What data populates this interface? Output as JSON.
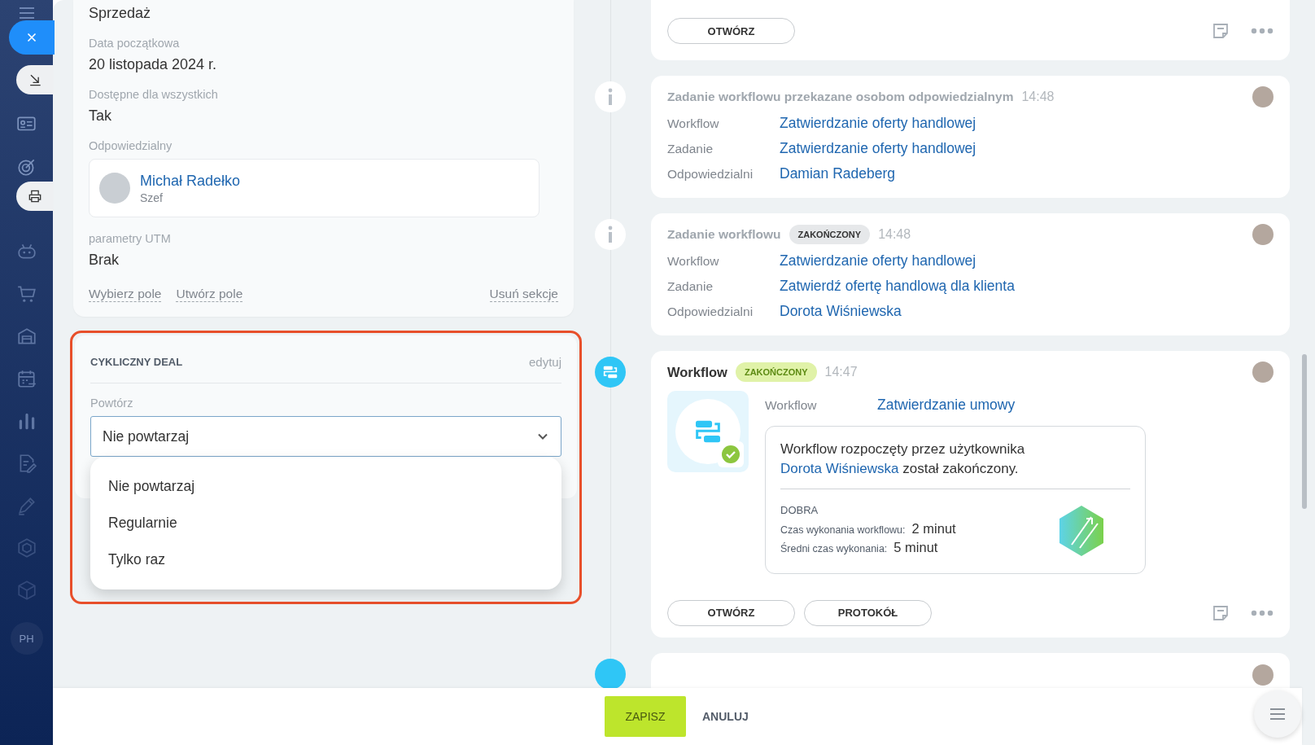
{
  "sidebar": {
    "avatar_initials": "PH"
  },
  "left_panel": {
    "fields": [
      {
        "kind": "value",
        "value": "Sprzedaż"
      },
      {
        "kind": "field",
        "label": "Data początkowa",
        "value": "20 listopada 2024 r."
      },
      {
        "kind": "field",
        "label": "Dostępne dla wszystkich",
        "value": "Tak"
      },
      {
        "kind": "person",
        "label": "Odpowiedzialny",
        "name": "Michał Radełko",
        "role": "Szef"
      },
      {
        "kind": "field",
        "label": "parametry UTM",
        "value": "Brak"
      }
    ],
    "links": [
      "Wybierz pole",
      "Utwórz pole"
    ],
    "remove_link": "Usuń sekcje"
  },
  "recurring_section": {
    "title": "CYKLICZNY DEAL",
    "edit": "edytuj",
    "highlighted": true,
    "field_label": "Powtórz",
    "value": "Nie powtarzaj",
    "expanded": true,
    "options": [
      "Nie powtarzaj",
      "Regularnie",
      "Tylko raz"
    ]
  },
  "timeline": [
    {
      "kind": "actions",
      "buttons": [
        "OTWÓRZ"
      ]
    },
    {
      "kind": "info",
      "title": "Zadanie workflowu przekazane osobom odpowiedzialnym",
      "time": "14:48",
      "rows": [
        {
          "label": "Workflow",
          "value": "Zatwierdzanie oferty handlowej"
        },
        {
          "label": "Zadanie",
          "value": "Zatwierdzanie oferty handlowej"
        },
        {
          "label": "Odpowiedzialni",
          "value": "Damian Radeberg"
        }
      ]
    },
    {
      "kind": "info",
      "title": "Zadanie workflowu",
      "badge": {
        "text": "ZAKOŃCZONY",
        "kind": "neutral"
      },
      "time": "14:48",
      "rows": [
        {
          "label": "Workflow",
          "value": "Zatwierdzanie oferty handlowej"
        },
        {
          "label": "Zadanie",
          "value": "Zatwierdź ofertę handlową dla klienta"
        },
        {
          "label": "Odpowiedzialni",
          "value": "Dorota Wiśniewska"
        }
      ]
    },
    {
      "kind": "workflow",
      "title": "Workflow",
      "badge": {
        "text": "ZAKOŃCZONY",
        "kind": "success"
      },
      "time": "14:47",
      "rows": [
        {
          "label": "Workflow",
          "value": "Zatwierdzanie umowy"
        }
      ],
      "message_before": "Workflow rozpoczęty przez użytkownika ",
      "message_link": "Dorota Wiśniewska",
      "message_after": " został zakończony.",
      "rating": "DOBRA",
      "stats": [
        {
          "label": "Czas wykonania workflowu:",
          "value": "2 minut"
        },
        {
          "label": "Średni czas wykonania:",
          "value": "5 minut"
        }
      ],
      "buttons": [
        "OTWÓRZ",
        "PROTOKÓŁ"
      ]
    },
    {
      "kind": "partial"
    }
  ],
  "footer": {
    "save": "ZAPISZ",
    "cancel": "ANULUJ"
  }
}
